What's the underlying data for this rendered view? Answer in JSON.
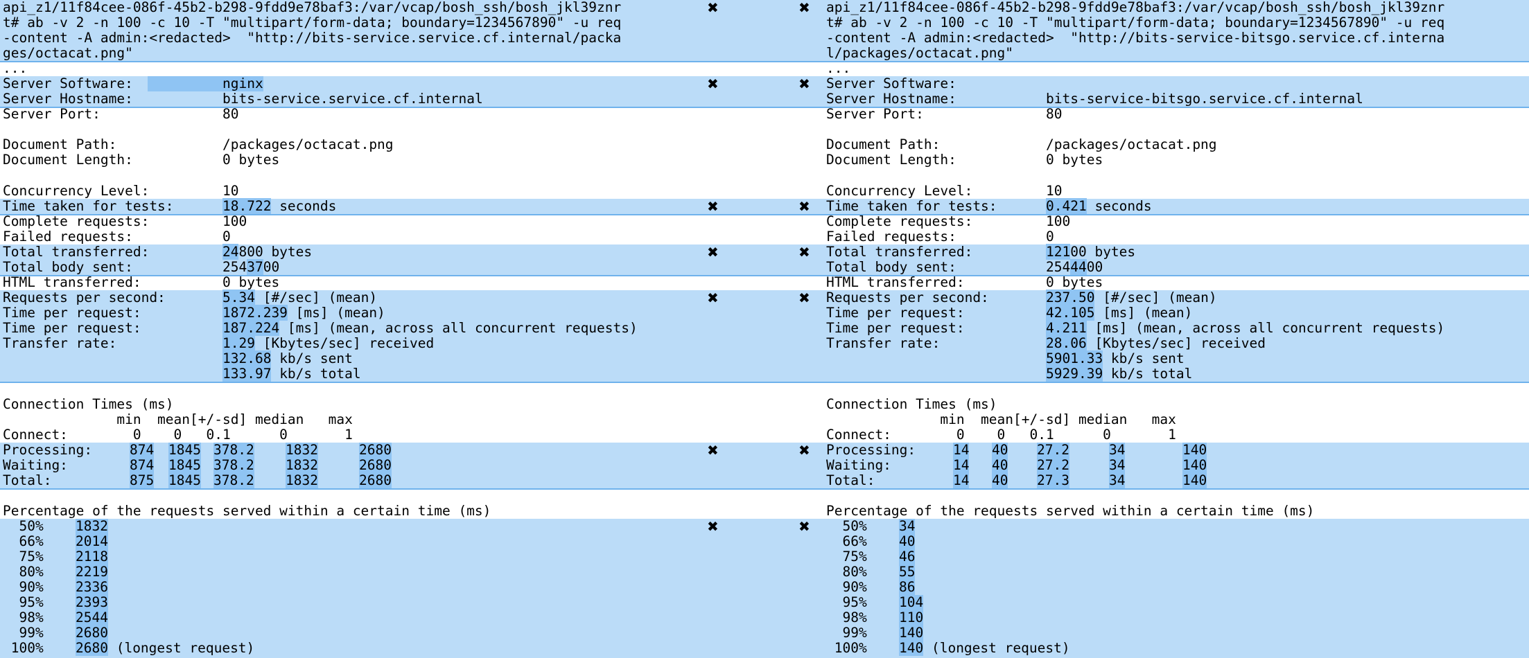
{
  "colors": {
    "band": "#bbdcf8",
    "band_border": "#6fb2ec",
    "highlight": "#8fc4f3"
  },
  "icons": {
    "remove": "close-icon"
  },
  "left": {
    "cmd": [
      "api_z1/11f84cee-086f-45b2-b298-9fdd9e78baf3:/var/vcap/bosh_ssh/bosh_jkl39znr",
      "t# ab -v 2 -n 100 -c 10 -T \"multipart/form-data; boundary=1234567890\" -u req",
      "-content -A admin:<redacted>  \"http://bits-service.service.cf.internal/packa",
      "ges/octacat.png\""
    ],
    "ellipsis": "...",
    "server_software_label": "Server Software:",
    "server_software": "nginx",
    "server_hostname_label": "Server Hostname:",
    "server_hostname": "bits-service.service.cf.internal",
    "server_port_label": "Server Port:",
    "server_port": "80",
    "document_path_label": "Document Path:",
    "document_path": "/packages/octacat.png",
    "document_length_label": "Document Length:",
    "document_length": "0 bytes",
    "concurrency_label": "Concurrency Level:",
    "concurrency": "10",
    "time_taken_label": "Time taken for tests:",
    "time_taken_num": "18.722",
    "time_taken_unit": " seconds",
    "complete_label": "Complete requests:",
    "complete": "100",
    "failed_label": "Failed requests:",
    "failed": "0",
    "total_transferred_label": "Total transferred:",
    "total_transferred_hl": "24",
    "total_transferred_rest": "800 bytes",
    "total_body_label": "Total body sent:",
    "total_body_pre": "254",
    "total_body_hl": "37",
    "total_body_post": "00",
    "html_transferred_label": "HTML transferred:",
    "html_transferred": "0 bytes",
    "rps_label": "Requests per second:",
    "rps_num": "5.34",
    "rps_unit": " [#/sec] (mean)",
    "tpr_label": "Time per request:",
    "tpr_num": "1872.239",
    "tpr_unit": " [ms] (mean)",
    "tpr2_label": "Time per request:",
    "tpr2_num": "187.224",
    "tpr2_unit": " [ms] (mean, across all concurrent requests)",
    "transfer_label": "Transfer rate:",
    "transfer_num": "1.29",
    "transfer_unit": " [Kbytes/sec] received",
    "sent_num": "132.68",
    "sent_unit": " kb/s sent",
    "total_num": "133.97",
    "total_unit": " kb/s total",
    "conn_title": "Connection Times (ms)",
    "conn_header": "              min  mean[+/-sd] median   max",
    "connect_line": "Connect:        0    0   0.1      0       1",
    "processing_label": "Processing:",
    "processing": [
      "874",
      "1845",
      "378.2",
      "1832",
      "2680"
    ],
    "waiting_label": "Waiting:",
    "waiting": [
      "874",
      "1845",
      "378.2",
      "1832",
      "2680"
    ],
    "total_row_label": "Total:",
    "total_row": [
      "875",
      "1845",
      "378.2",
      "1832",
      "2680"
    ],
    "percent_title": "Percentage of the requests served within a certain time (ms)",
    "percentiles": [
      {
        "p": "  50%",
        "v": "1832"
      },
      {
        "p": "  66%",
        "v": "2014"
      },
      {
        "p": "  75%",
        "v": "2118"
      },
      {
        "p": "  80%",
        "v": "2219"
      },
      {
        "p": "  90%",
        "v": "2336"
      },
      {
        "p": "  95%",
        "v": "2393"
      },
      {
        "p": "  98%",
        "v": "2544"
      },
      {
        "p": "  99%",
        "v": "2680"
      },
      {
        "p": " 100%",
        "v": "2680"
      }
    ],
    "longest": " (longest request)"
  },
  "right": {
    "cmd": [
      "api_z1/11f84cee-086f-45b2-b298-9fdd9e78baf3:/var/vcap/bosh_ssh/bosh_jkl39znr",
      "t# ab -v 2 -n 100 -c 10 -T \"multipart/form-data; boundary=1234567890\" -u req",
      "-content -A admin:<redacted>  \"http://bits-service-bitsgo.service.cf.interna",
      "l/packages/octacat.png\""
    ],
    "ellipsis": "...",
    "server_software_label": "Server Software:",
    "server_software": "",
    "server_hostname_label": "Server Hostname:",
    "server_hostname": "bits-service-bitsgo.service.cf.internal",
    "server_port_label": "Server Port:",
    "server_port": "80",
    "document_path_label": "Document Path:",
    "document_path": "/packages/octacat.png",
    "document_length_label": "Document Length:",
    "document_length": "0 bytes",
    "concurrency_label": "Concurrency Level:",
    "concurrency": "10",
    "time_taken_label": "Time taken for tests:",
    "time_taken_num": "0.421",
    "time_taken_unit": " seconds",
    "complete_label": "Complete requests:",
    "complete": "100",
    "failed_label": "Failed requests:",
    "failed": "0",
    "total_transferred_label": "Total transferred:",
    "total_transferred_hl": "121",
    "total_transferred_rest": "00 bytes",
    "total_body_label": "Total body sent:",
    "total_body_pre": "254",
    "total_body_hl": "44",
    "total_body_post": "00",
    "html_transferred_label": "HTML transferred:",
    "html_transferred": "0 bytes",
    "rps_label": "Requests per second:",
    "rps_num": "237.50",
    "rps_unit": " [#/sec] (mean)",
    "tpr_label": "Time per request:",
    "tpr_num": "42.105",
    "tpr_unit": " [ms] (mean)",
    "tpr2_label": "Time per request:",
    "tpr2_num": "4.211",
    "tpr2_unit": " [ms] (mean, across all concurrent requests)",
    "transfer_label": "Transfer rate:",
    "transfer_num": "28.06",
    "transfer_unit": " [Kbytes/sec] received",
    "sent_num": "5901.33",
    "sent_unit": " kb/s sent",
    "total_num": "5929.39",
    "total_unit": " kb/s total",
    "conn_title": "Connection Times (ms)",
    "conn_header": "              min  mean[+/-sd] median   max",
    "connect_line": "Connect:        0    0   0.1      0       1",
    "processing_label": "Processing:",
    "processing": [
      "14",
      "40",
      "27.2",
      "34",
      "140"
    ],
    "waiting_label": "Waiting:",
    "waiting": [
      "14",
      "40",
      "27.2",
      "34",
      "140"
    ],
    "total_row_label": "Total:",
    "total_row": [
      "14",
      "40",
      "27.3",
      "34",
      "140"
    ],
    "percent_title": "Percentage of the requests served within a certain time (ms)",
    "percentiles": [
      {
        "p": "  50%",
        "v": "34"
      },
      {
        "p": "  66%",
        "v": "40"
      },
      {
        "p": "  75%",
        "v": "46"
      },
      {
        "p": "  80%",
        "v": "55"
      },
      {
        "p": "  90%",
        "v": "86"
      },
      {
        "p": "  95%",
        "v": "104"
      },
      {
        "p": "  98%",
        "v": "110"
      },
      {
        "p": "  99%",
        "v": "140"
      },
      {
        "p": " 100%",
        "v": "140"
      }
    ],
    "longest": " (longest request)"
  },
  "close_glyph": "✖"
}
